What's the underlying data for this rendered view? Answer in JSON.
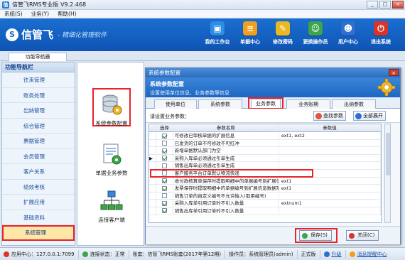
{
  "window": {
    "title": "信管飞RMS专业版 V9.2.468",
    "app_icon": "信",
    "controls": {
      "minimize": "_",
      "maximize": "□",
      "close": "×"
    }
  },
  "menu": [
    "系统(S)",
    "业务(Y)",
    "帮助(H)"
  ],
  "banner": {
    "logo_mark": "S",
    "logo_name": "信管飞",
    "slogan": "- 精细化管理软件",
    "nav": [
      {
        "label": "我的工作台",
        "icon": "monitor-icon",
        "color": "#2e8ee6",
        "glyph": "▣"
      },
      {
        "label": "单据中心",
        "icon": "document-icon",
        "color": "#f0a01e",
        "glyph": "≡"
      },
      {
        "label": "修改密码",
        "icon": "key-icon",
        "color": "#e8b923",
        "glyph": "✎"
      },
      {
        "label": "更换操作员",
        "icon": "user-switch-icon",
        "color": "#3fa34d",
        "glyph": "☺"
      },
      {
        "label": "用户中心",
        "icon": "user-center-icon",
        "color": "#2f6fd0",
        "glyph": "☻"
      },
      {
        "label": "退出系统",
        "icon": "power-icon",
        "color": "#d8342a",
        "glyph": "⏻"
      }
    ]
  },
  "tab_strip": {
    "active_tab": "功能导航器"
  },
  "leftnav": {
    "title": "功能导航栏",
    "items": [
      "往来管理",
      "账务处理",
      "出纳管理",
      "综合管理",
      "票据管理",
      "会员管理",
      "客户关系",
      "绩效考核",
      "扩展应用",
      "基础资料",
      "系统管理"
    ],
    "selected_index": 10
  },
  "modules": [
    {
      "label": "系统参数配置",
      "icon": "database-config-icon"
    },
    {
      "label": "单据业务参数",
      "icon": "document-settings-icon"
    },
    {
      "label": "连接客户端",
      "icon": "network-icon"
    }
  ],
  "dialog": {
    "title": "系统参数配置",
    "close": "×",
    "header_title": "系统参数配置",
    "header_subtitle": "设置使用单位信息、业务参数等信息",
    "tabs": [
      "使用单位",
      "系统参数",
      "业务参数",
      "业务账期",
      "出纳参数"
    ],
    "selected_tab": 2,
    "tools_label": "请设置业务参数：",
    "find_button": "查找参数",
    "expand_button": "全部展开",
    "grid": {
      "headers": [
        "选择",
        "参数名称",
        "参数值"
      ],
      "rows": [
        {
          "checked": true,
          "name": "可修改已审核单据的扩展信息",
          "value": "ext1, ext2"
        },
        {
          "checked": false,
          "name": "已发货的订单不可修改不可红冲",
          "value": ""
        },
        {
          "checked": true,
          "name": "新增单据默认部门为空",
          "value": ""
        },
        {
          "checked": true,
          "name": "采购入库单必须通过引单生成",
          "value": "",
          "highlight": true
        },
        {
          "checked": false,
          "name": "销售出库单必须通过引单生成",
          "value": ""
        },
        {
          "checked": false,
          "name": "客户服务平台订单默认物流快递",
          "value": ""
        },
        {
          "checked": true,
          "name": "收付款核算单保存时提取明细中的单据编号到扩展信息数据",
          "value": "ext1"
        },
        {
          "checked": true,
          "name": "发票保存时提取明细中的单据编号到扩展信息数据项",
          "value": "ext1"
        },
        {
          "checked": false,
          "name": "销售订单的自定义编号不允许输入(取用编号)",
          "value": ""
        },
        {
          "checked": true,
          "name": "采购入库单引用订单时不引入数量",
          "value": "extnum1"
        },
        {
          "checked": true,
          "name": "销售出库单引用订单时不引入数量",
          "value": ""
        }
      ]
    },
    "save_button": "保存(S)",
    "close_button": "关闭(C)"
  },
  "status": {
    "app_center": "应用中心：127.0.0.1:7099",
    "connection": "连接状态：正常",
    "account_set": "账套：信管飞RMS账套(2017年第12期)",
    "operator": "操作员：系统管理员(admin)",
    "edition": "正式版",
    "upgrade": "升级",
    "message_center": "消息提醒中心"
  },
  "colors": {
    "banner": "#1a6fd0",
    "highlight": "#e8232a",
    "selected_nav": "#ffe7a8",
    "dialog_header": "#1f66c2"
  }
}
